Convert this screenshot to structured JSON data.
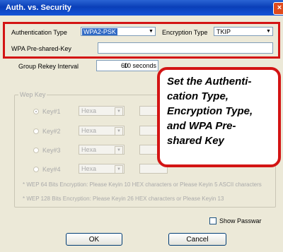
{
  "window": {
    "title": "Auth. vs. Security",
    "close_symbol": "×"
  },
  "auth": {
    "label": "Authentication Type",
    "value": "WPA2-PSK",
    "arrow": "▼"
  },
  "encryption": {
    "label": "Encryption Type",
    "value": "TKIP",
    "arrow": "▼"
  },
  "psk": {
    "label": "WPA Pre-shared-Key",
    "value": ""
  },
  "rekey": {
    "label": "Group Rekey Interval",
    "value": "60",
    "unit": "10 seconds"
  },
  "wep": {
    "group_label": "Wep Key",
    "keys": [
      {
        "label": "Key#1",
        "format": "Hexa",
        "selected": true
      },
      {
        "label": "Key#2",
        "format": "Hexa",
        "selected": false
      },
      {
        "label": "Key#3",
        "format": "Hexa",
        "selected": false
      },
      {
        "label": "Key#4",
        "format": "Hexa",
        "selected": false
      }
    ],
    "note_1": "* WEP 64 Bits Encryption:  Please Keyin 10 HEX characters  or  Please Keyin 5 ASCII characters",
    "note_2": "* WEP 128 Bits Encryption:  Please Keyin 26 HEX characters  or  Please Keyin 13"
  },
  "show_password": {
    "label": "Show Passwar",
    "checked": false
  },
  "buttons": {
    "ok": "OK",
    "cancel": "Cancel"
  },
  "callout": {
    "text": "Set the Authenti-\ncation Type,\nEncryption Type,\nand WPA Pre-\nshared Key",
    "border_color": "#d31414"
  }
}
